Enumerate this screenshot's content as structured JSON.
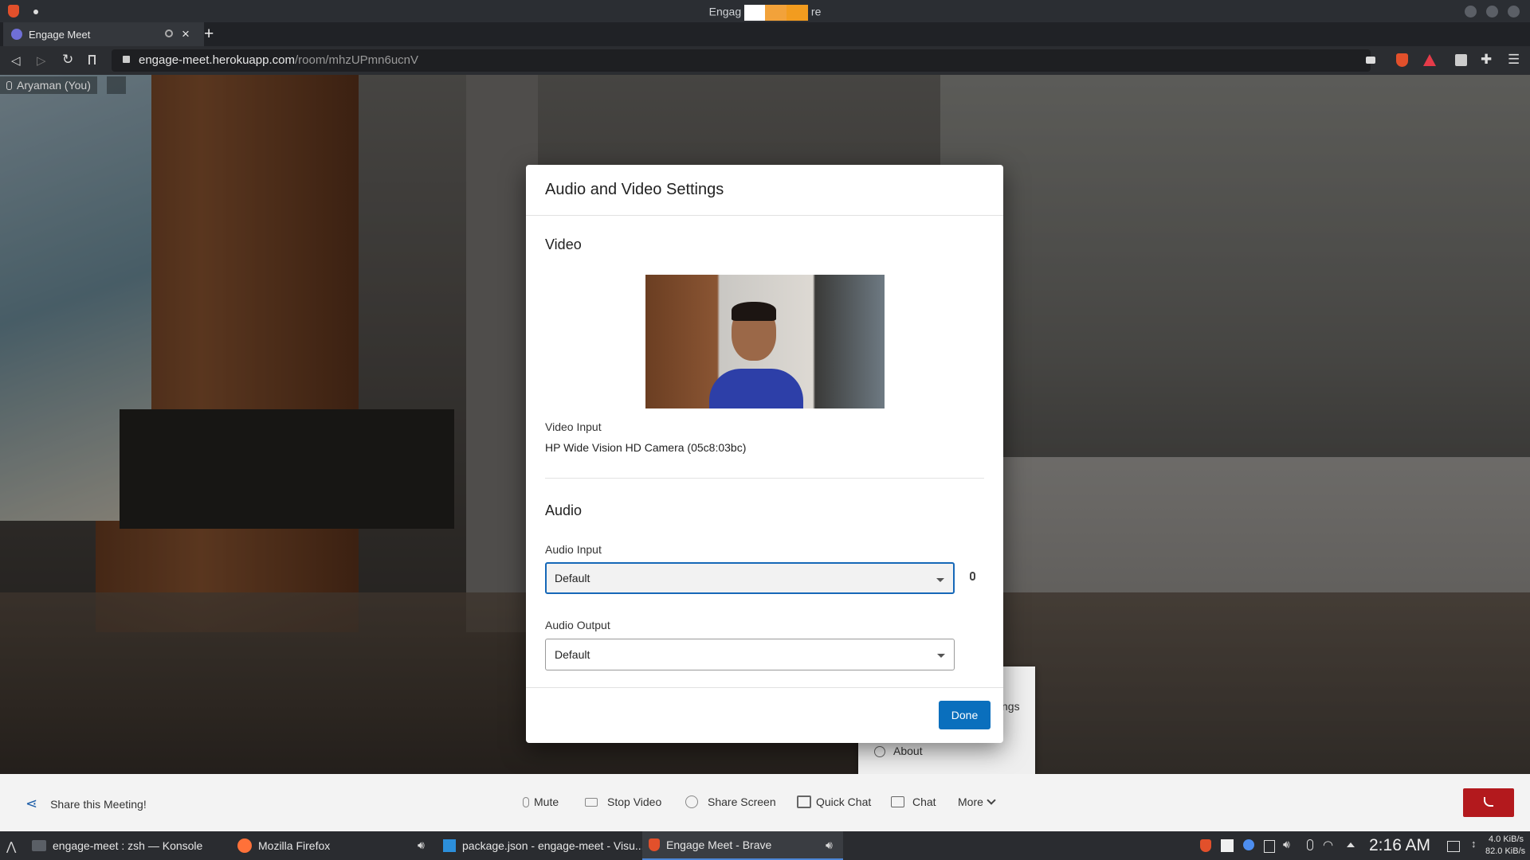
{
  "window": {
    "title_left": "Engag",
    "title_right": "re"
  },
  "tab": {
    "label": "Engage Meet",
    "close": "×",
    "new": "+"
  },
  "url": {
    "host": "engage-meet.herokuapp.com",
    "path": "/room/mhzUPmn6ucnV"
  },
  "participant": {
    "name": "Aryaman (You)"
  },
  "dialog": {
    "title": "Audio and Video Settings",
    "video_section": "Video",
    "video_input_label": "Video Input",
    "video_input_value": "HP Wide Vision HD Camera (05c8:03bc)",
    "audio_section": "Audio",
    "audio_input_label": "Audio Input",
    "audio_input_value": "Default",
    "audio_output_label": "Audio Output",
    "audio_output_value": "Default",
    "done": "Done"
  },
  "menu": {
    "partial": "ngs",
    "about": "About"
  },
  "bottombar": {
    "share": "Share this Meeting!",
    "mute": "Mute",
    "stop_video": "Stop Video",
    "share_screen": "Share Screen",
    "quick_chat": "Quick Chat",
    "chat": "Chat",
    "more": "More"
  },
  "taskbar": {
    "konsole": "engage-meet : zsh — Konsole",
    "firefox": "Mozilla Firefox",
    "vscode": "package.json - engage-meet - Visu...",
    "brave": "Engage Meet - Brave",
    "clock": "2:16 AM",
    "net_down": "4.0 KiB/s",
    "net_up": "82.0 KiB/s"
  },
  "colors": {
    "accent": "#0a6fbd",
    "end_call": "#b3191d"
  }
}
